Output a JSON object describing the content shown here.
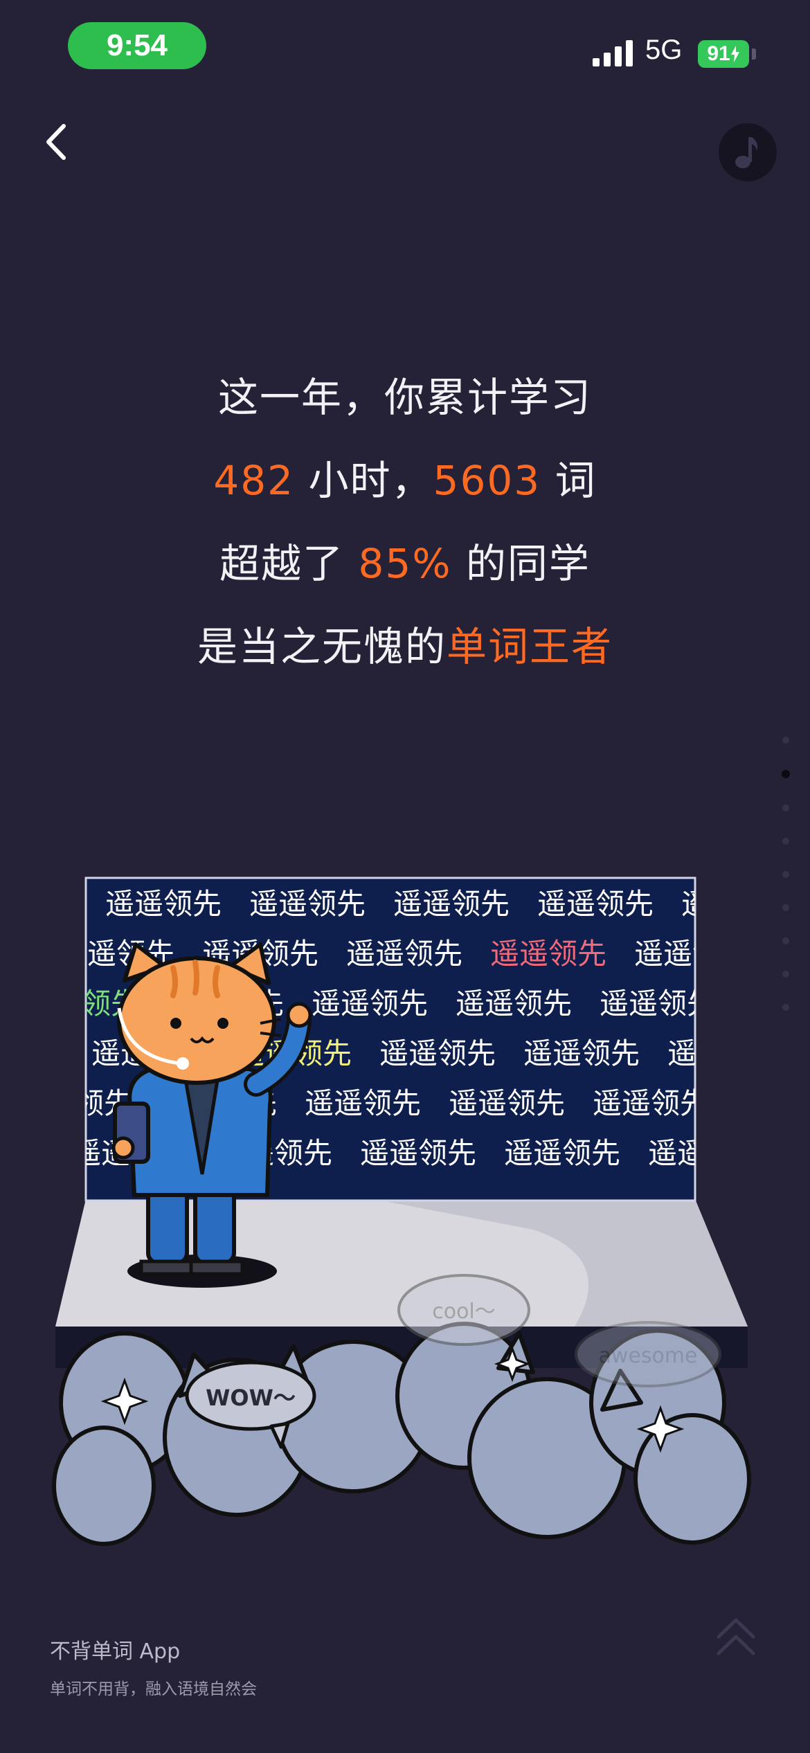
{
  "status_bar": {
    "time": "9:54",
    "network": "5G",
    "battery": "91"
  },
  "summary": {
    "line1": "这一年，你累计学习",
    "hours": "482",
    "hours_unit": "小时，",
    "words": "5603",
    "words_unit": "词",
    "beat_prefix": "超越了",
    "percent": "85%",
    "beat_suffix": "的同学",
    "title_prefix": "是当之无愧的",
    "title_highlight": "单词王者"
  },
  "illustration": {
    "screen_word": "遥遥领先",
    "bubble_wow": "WOW～",
    "bubble_cool": "cool～",
    "bubble_awesome": "awesome"
  },
  "pager": {
    "count": 9,
    "active_index": 1
  },
  "footer": {
    "app_name": "不背单词 App",
    "slogan": "单词不用背，融入语境自然会"
  },
  "colors": {
    "background": "#252238",
    "accent": "#ff6a22",
    "time_pill": "#2dbe4e",
    "battery": "#34c759"
  },
  "icons": {
    "back": "chevron-left-icon",
    "music": "music-note-icon",
    "scroll_up": "double-chevron-up-icon"
  }
}
